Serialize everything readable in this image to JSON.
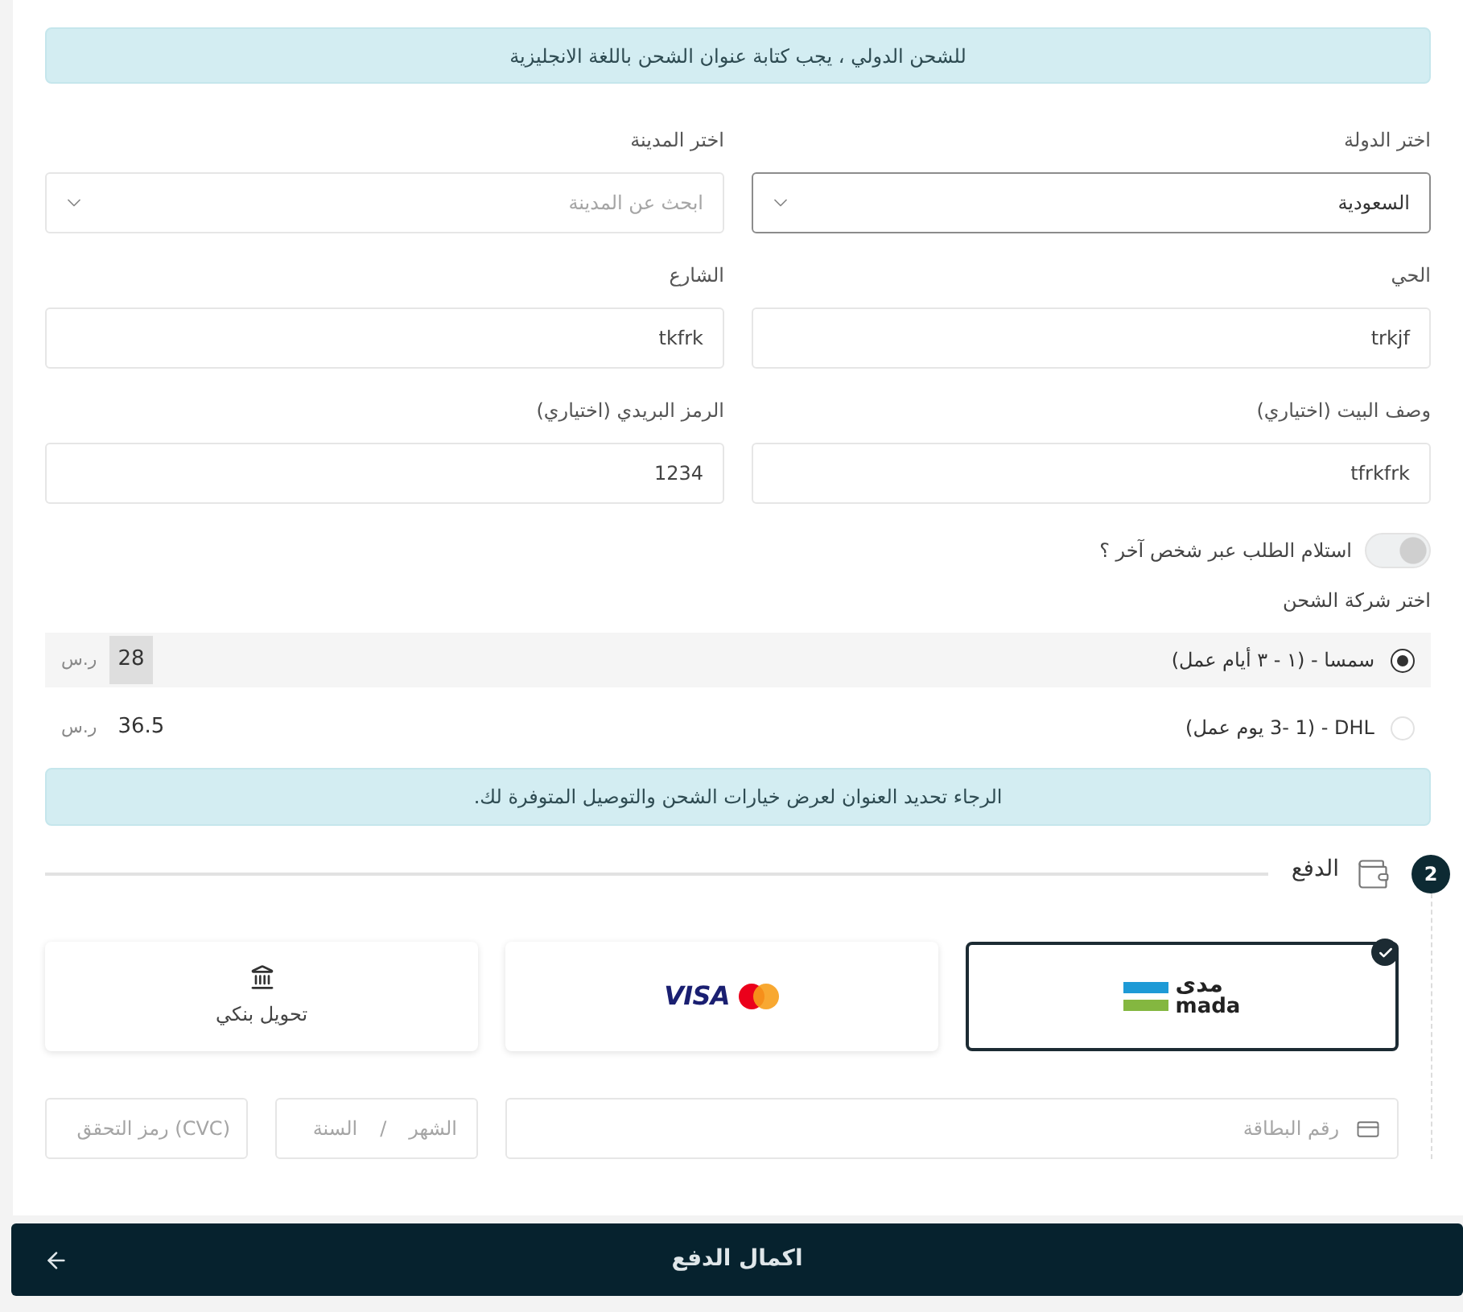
{
  "international_notice": "للشحن الدولي ، يجب كتابة عنوان الشحن باللغة الانجليزية",
  "address_fields": [
    {
      "kind": "select",
      "label": "اختر الدولة",
      "value": "السعودية",
      "focused": true
    },
    {
      "kind": "select",
      "label": "اختر المدينة",
      "placeholder": "ابحث عن المدينة",
      "focused": false
    },
    {
      "kind": "text",
      "label": "الحي",
      "value": "trkjf"
    },
    {
      "kind": "text",
      "label": "الشارع",
      "value": "tkfrk"
    },
    {
      "kind": "text",
      "label": "وصف البيت (اختياري)",
      "value": "tfrkfrk"
    },
    {
      "kind": "text",
      "label": "الرمز البريدي (اختياري)",
      "value": "1234"
    }
  ],
  "pickup_toggle": {
    "label": "استلام الطلب عبر شخص آخر ؟",
    "on": false
  },
  "shipping": {
    "title": "اختر شركة الشحن",
    "options": [
      {
        "name": "سمسا - (١ - ٣ أيام عمل)",
        "price": "28",
        "currency": "ر.س",
        "selected": true
      },
      {
        "name": "DHL - (3- 1 يوم عمل)",
        "price": "36.5",
        "currency": "ر.س",
        "selected": false
      }
    ],
    "notice": "الرجاء تحديد العنوان لعرض خيارات الشحن والتوصيل المتوفرة لك."
  },
  "payment": {
    "step": "2",
    "title": "الدفع",
    "methods": [
      {
        "kind": "mada",
        "logo_arabic": "مدى",
        "logo_latin": "mada",
        "selected": true
      },
      {
        "kind": "card_brands",
        "logo_text": "VISA",
        "selected": false
      },
      {
        "kind": "bank_transfer",
        "label": "تحويل بنكي",
        "selected": false
      }
    ],
    "card_fields": {
      "number_placeholder": "رقم البطاقة",
      "month_placeholder": "الشهر",
      "separator": "/",
      "year_placeholder": "السنة",
      "cvc_placeholder": "(CVC) رمز التحقق"
    }
  },
  "submit_button": {
    "label": "اكمال الدفع"
  }
}
